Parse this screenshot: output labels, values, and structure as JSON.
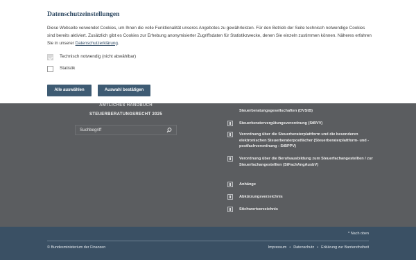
{
  "dialog": {
    "title": "Datenschutzeinstellungen",
    "text": "Diese Webseite verwendet Cookies, um Ihnen die volle Funktionalität unseres Angebotes zu gewährleisten. Für den Betrieb der Seite technisch notwendige Cookies sind bereits aktiviert. Zusätzlich gibt es Cookies zur Erhebung anonymisierter Zugriffsdaten für Statistikzwecke, denen Sie einzeln zustimmen können. Näheres erfahren Sie in unserer ",
    "privacy_link": "Datenschutzerklärung",
    "text_end": ".",
    "options": [
      {
        "label": "Technisch notwendig (nicht abwählbar)",
        "checked": true,
        "disabled": true
      },
      {
        "label": "Statistik",
        "checked": false,
        "disabled": false
      }
    ],
    "btn_all": "Alle auswählen",
    "btn_confirm": "Auswahl bestätigen"
  },
  "left": {
    "title_line1": "AMTLICHES HANDBUCH",
    "title_line2": "STEUERBERATUNGSRECHT 2025",
    "search_placeholder": "Suchbegriff"
  },
  "toc": [
    "Steuerberatungsgesellschaften (DVStB)",
    "Steuerberatervergütungsverordnung (StBVV)",
    "Verordnung über die Steuerberaterplattform und die besonderen elektronischen Steuerberaterpostfächer (Steuerberaterplattform- und -postfachverordnung - StBPPV)",
    "Verordnung über die Berufsausbildung zum Steuerfachangestellten / zur Steuerfachangestellten (StFachAngAusbV)",
    "Anhänge",
    "Abkürzungsverzeichnis",
    "Stichwortverzeichnis"
  ],
  "footer": {
    "back_to_top": "^ Nach oben",
    "copyright": "© Bundesministerium der Finanzen",
    "links": [
      "Impressum",
      "Datenschutz",
      "Erklärung zur Barrierefreiheit"
    ]
  }
}
